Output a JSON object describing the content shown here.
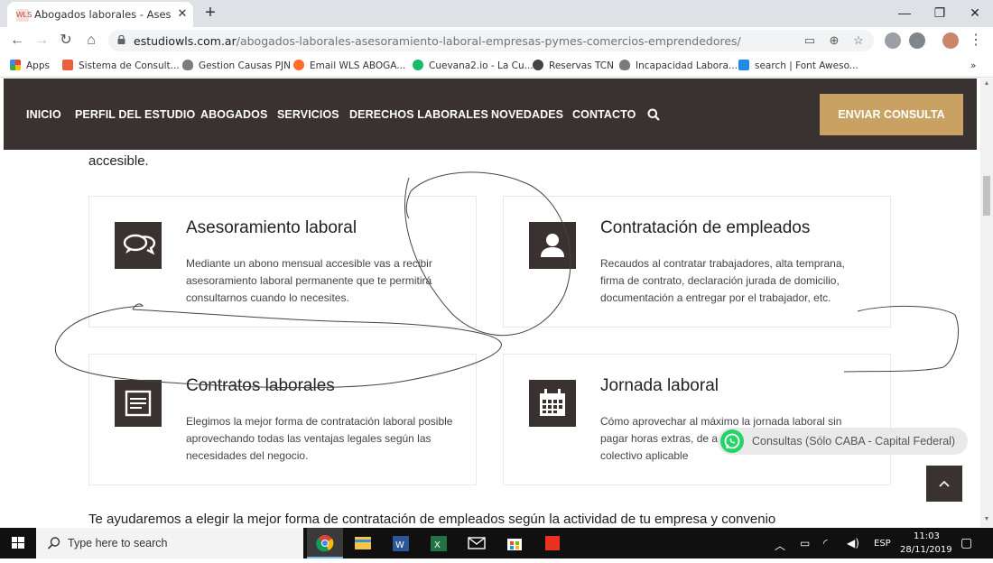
{
  "browser": {
    "tab_title": "Abogados laborales - Asesoramiento laboral",
    "tab_favicon": "WLS",
    "url_domain": "estudiowls.com.ar",
    "url_path": "/abogados-laborales-asesoramiento-laboral-empresas-pymes-comercios-emprendedores/",
    "bookmarks": [
      {
        "label": "Apps",
        "icon": "apps-grid-icon",
        "color": "#ea4335"
      },
      {
        "label": "Sistema de Consult...",
        "icon": "doc-icon",
        "color": "#e8603c"
      },
      {
        "label": "Gestion Causas PJN",
        "icon": "shield-icon",
        "color": "#7b7b7b"
      },
      {
        "label": "Email WLS ABOGA...",
        "icon": "cpanel-icon",
        "color": "#ff6c2c"
      },
      {
        "label": "Cuevana2.io - La Cu...",
        "icon": "play-icon",
        "color": "#19b96b"
      },
      {
        "label": "Reservas TCN",
        "icon": "globe-icon",
        "color": "#444444"
      },
      {
        "label": "Incapacidad Labora...",
        "icon": "shield-icon",
        "color": "#7b7b7b"
      },
      {
        "label": "search | Font Aweso...",
        "icon": "flag-icon",
        "color": "#228ae6"
      }
    ]
  },
  "site": {
    "nav": [
      "INICIO",
      "PERFIL DEL ESTUDIO",
      "ABOGADOS",
      "SERVICIOS",
      "DERECHOS LABORALES",
      "NOVEDADES",
      "CONTACTO"
    ],
    "cta": "ENVIAR CONSULTA",
    "intro_tail": "accesible.",
    "cards": [
      {
        "title": "Asesoramiento laboral",
        "icon": "chat-bubbles-icon",
        "text": "Mediante un abono mensual accesible vas a recibir asesoramiento laboral permanente que te permitirá consultarnos cuando lo necesites."
      },
      {
        "title": "Contratación de empleados",
        "icon": "user-icon",
        "text": "Recaudos al contratar trabajadores, alta temprana, firma de contrato, declaración jurada de domicilio, documentación a entregar por el trabajador, etc."
      },
      {
        "title": "Contratos laborales",
        "icon": "contract-icon",
        "text": "Elegimos la mejor forma de contratación laboral posible aprovechando todas las ventajas legales según las necesidades del negocio."
      },
      {
        "title": "Jornada laboral",
        "icon": "calendar-icon",
        "text": "Cómo aprovechar al máximo la jornada laboral sin pagar horas extras, de a... empresa y convenio colectivo aplicable"
      }
    ],
    "bottom_text": "Te ayudaremos a elegir la mejor forma de contratación de empleados según la actividad de tu empresa y convenio",
    "whatsapp": "Consultas (Sólo CABA - Capital Federal)"
  },
  "taskbar": {
    "search_placeholder": "Type here to search",
    "language": "ESP",
    "time": "11:03",
    "date": "28/11/2019"
  }
}
